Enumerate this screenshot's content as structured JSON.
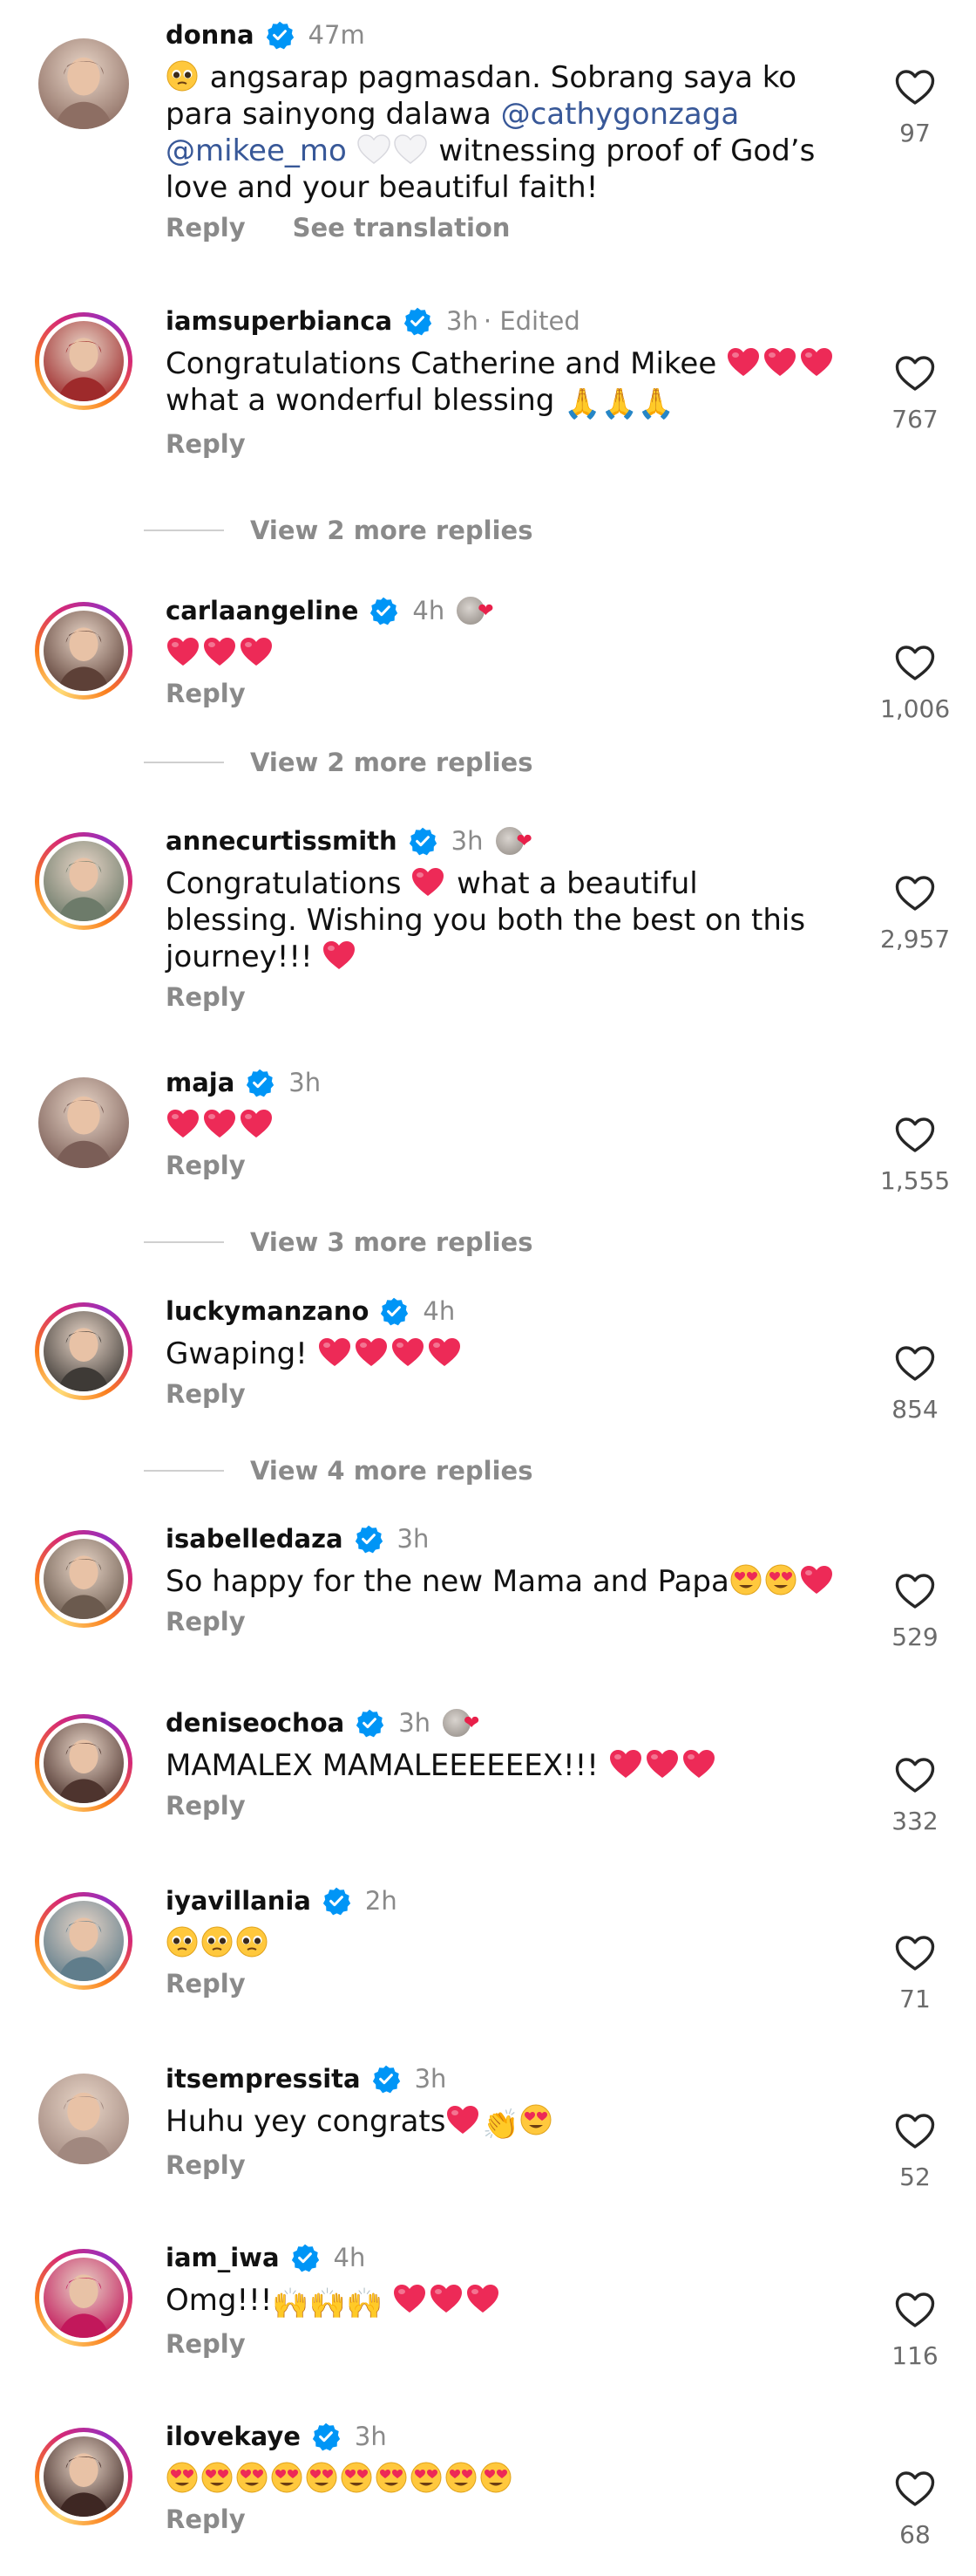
{
  "comments": [
    {
      "username": "donna",
      "time": "47m",
      "edited": "",
      "verified": true,
      "reaction_badge": false,
      "text_html": "<span class='face-e emo-plead'></span> angsarap pagmasdan. Sobrang saya ko para sainyong dalawa <span class='mention'>@cathygonzaga</span> <span class='mention'>@mikee_mo</span> <span class='heart-e emo-white'></span><span class='heart-e emo-white'></span> witnessing proof of God’s love and your beautiful faith!",
      "actions": [
        "Reply",
        "See translation"
      ],
      "likes": "97",
      "avatar": "#8d6e63"
    },
    {
      "username": "iamsuperbianca",
      "time": "3h",
      "edited": "· Edited",
      "verified": true,
      "reaction_badge": false,
      "text_html": "Congratulations Catherine and Mikee <span class='heart-e emo-heart'></span><span class='heart-e emo-heart'></span><span class='heart-e emo-heart'></span> what a wonderful blessing <span class='emoji'>🙏🙏🙏</span>",
      "actions": [
        "Reply"
      ],
      "likes": "767",
      "avatar": "#9e2a2b"
    },
    {
      "username": "carlaangeline",
      "time": "4h",
      "edited": "",
      "verified": true,
      "reaction_badge": true,
      "text_html": "<span class='heart-e emo-heart'></span><span class='heart-e emo-heart'></span><span class='heart-e emo-heart'></span>",
      "actions": [
        "Reply"
      ],
      "likes": "1,006",
      "avatar": "#5d4037"
    },
    {
      "username": "annecurtissmith",
      "time": "3h",
      "edited": "",
      "verified": true,
      "reaction_badge": true,
      "text_html": "Congratulations <span class='heart-e emo-heart'></span> what a beautiful blessing. Wishing you both the best on this journey!!! <span class='heart-e emo-heart'></span>",
      "actions": [
        "Reply"
      ],
      "likes": "2,957",
      "avatar": "#6d7b6a"
    },
    {
      "username": "maja",
      "time": "3h",
      "edited": "",
      "verified": true,
      "reaction_badge": false,
      "text_html": "<span class='heart-e emo-heart'></span><span class='heart-e emo-heart'></span><span class='heart-e emo-heart'></span>",
      "actions": [
        "Reply"
      ],
      "likes": "1,555",
      "avatar": "#7b5e57"
    },
    {
      "username": "luckymanzano",
      "time": "4h",
      "edited": "",
      "verified": true,
      "reaction_badge": false,
      "text_html": "Gwaping! <span class='heart-e emo-heart'></span><span class='heart-e emo-heart'></span><span class='heart-e emo-heart'></span><span class='heart-e emo-heart'></span>",
      "actions": [
        "Reply"
      ],
      "likes": "854",
      "avatar": "#3e3a36"
    },
    {
      "username": "isabelledaza",
      "time": "3h",
      "edited": "",
      "verified": true,
      "reaction_badge": false,
      "text_html": "So happy for the new Mama and Papa<span class='face-e emo-hearteyes'></span><span class='face-e emo-hearteyes'></span><span class='heart-e emo-heart'></span>",
      "actions": [
        "Reply"
      ],
      "likes": "529",
      "avatar": "#6b5a4e"
    },
    {
      "username": "deniseochoa",
      "time": "3h",
      "edited": "",
      "verified": true,
      "reaction_badge": true,
      "text_html": "MAMALEX MAMALEEEEEEX!!! <span class='heart-e emo-heart'></span><span class='heart-e emo-heart'></span><span class='heart-e emo-heart'></span>",
      "actions": [
        "Reply"
      ],
      "likes": "332",
      "avatar": "#4e342e"
    },
    {
      "username": "iyavillania",
      "time": "2h",
      "edited": "",
      "verified": true,
      "reaction_badge": false,
      "text_html": "<span class='face-e emo-plead'></span><span class='face-e emo-plead'></span><span class='face-e emo-plead'></span>",
      "actions": [
        "Reply"
      ],
      "likes": "71",
      "avatar": "#607d8b"
    },
    {
      "username": "itsempressita",
      "time": "3h",
      "edited": "",
      "verified": true,
      "reaction_badge": false,
      "text_html": "Huhu yey congrats<span class='heart-e emo-heart'></span><span class='emoji'>👏</span><span class='face-e emo-hearteyes'></span>",
      "actions": [
        "Reply"
      ],
      "likes": "52",
      "avatar": "#a1887f"
    },
    {
      "username": "iam_iwa",
      "time": "4h",
      "edited": "",
      "verified": true,
      "reaction_badge": false,
      "text_html": "Omg!!!<span class='emoji'>🙌🙌🙌</span> <span class='heart-e emo-heart'></span><span class='heart-e emo-heart'></span><span class='heart-e emo-heart'></span>",
      "actions": [
        "Reply"
      ],
      "likes": "116",
      "avatar": "#c2185b"
    },
    {
      "username": "ilovekaye",
      "time": "3h",
      "edited": "",
      "verified": true,
      "reaction_badge": false,
      "text_html": "<span class='face-e emo-hearteyes'></span><span class='face-e emo-hearteyes'></span><span class='face-e emo-hearteyes'></span><span class='face-e emo-hearteyes'></span><span class='face-e emo-hearteyes'></span><span class='face-e emo-hearteyes'></span><span class='face-e emo-hearteyes'></span><span class='face-e emo-hearteyes'></span><span class='face-e emo-hearteyes'></span><span class='face-e emo-hearteyes'></span>",
      "actions": [
        "Reply"
      ],
      "likes": "68",
      "avatar": "#3e2723"
    }
  ],
  "view_replies": [
    {
      "label": "View 2 more replies"
    },
    {
      "label": "View 2 more replies"
    },
    {
      "label": "View 3 more replies"
    },
    {
      "label": "View 4 more replies"
    }
  ],
  "colors": {
    "verified": "#0095f6",
    "heart": "#ed2a57",
    "mention": "#385898",
    "muted": "#8a8a8a"
  },
  "icons": {
    "like": "heart-outline-icon",
    "verified": "verified-badge-icon"
  }
}
